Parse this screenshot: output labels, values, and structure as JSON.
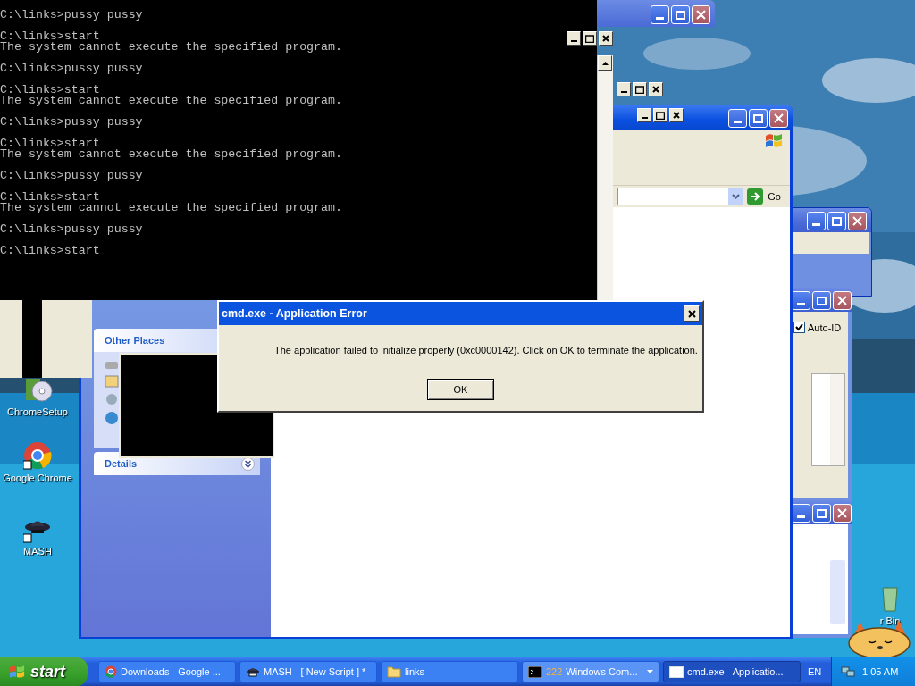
{
  "desktop_icons": [
    {
      "label": "ChromeSetup",
      "kind": "setup"
    },
    {
      "label": "Google Chrome",
      "kind": "chrome"
    },
    {
      "label": "MASH",
      "kind": "mash"
    },
    {
      "label": "r Bin",
      "kind": "recycle"
    }
  ],
  "console": {
    "blocks": [
      [
        "C:\\links>pussy pussy"
      ],
      [
        "C:\\links>start",
        "The system cannot execute the specified program."
      ],
      [
        "C:\\links>pussy pussy"
      ],
      [
        "C:\\links>start",
        "The system cannot execute the specified program."
      ],
      [
        "C:\\links>pussy pussy"
      ],
      [
        "C:\\links>start",
        "The system cannot execute the specified program."
      ],
      [
        "C:\\links>pussy pussy"
      ],
      [
        "C:\\links>start",
        "The system cannot execute the specified program."
      ],
      [
        "C:\\links>pussy pussy"
      ],
      [
        "C:\\links>start"
      ]
    ]
  },
  "explorer": {
    "go_button": "Go",
    "task_panes": [
      {
        "title": "Other Places",
        "expanded": true
      },
      {
        "title": "Details",
        "expanded": false
      }
    ]
  },
  "side_window": {
    "checkbox": {
      "label": "Auto-ID",
      "checked": true
    }
  },
  "dialog": {
    "title": "cmd.exe - Application Error",
    "message": "The application failed to initialize properly (0xc0000142). Click on OK to terminate the application.",
    "button": "OK"
  },
  "taskbar": {
    "start": "start",
    "tasks": [
      {
        "kind": "chrome",
        "label": "Downloads - Google ...",
        "selected": false
      },
      {
        "kind": "mash",
        "label": "MASH - [ New Script ] *",
        "selected": false
      },
      {
        "kind": "folder",
        "label": "links",
        "selected": false
      },
      {
        "kind": "console",
        "count": "222",
        "label": "Windows Com...",
        "selected": false
      },
      {
        "kind": "window",
        "label": "cmd.exe - Applicatio...",
        "selected": true
      }
    ],
    "language": "EN",
    "clock": "1:05 AM"
  }
}
